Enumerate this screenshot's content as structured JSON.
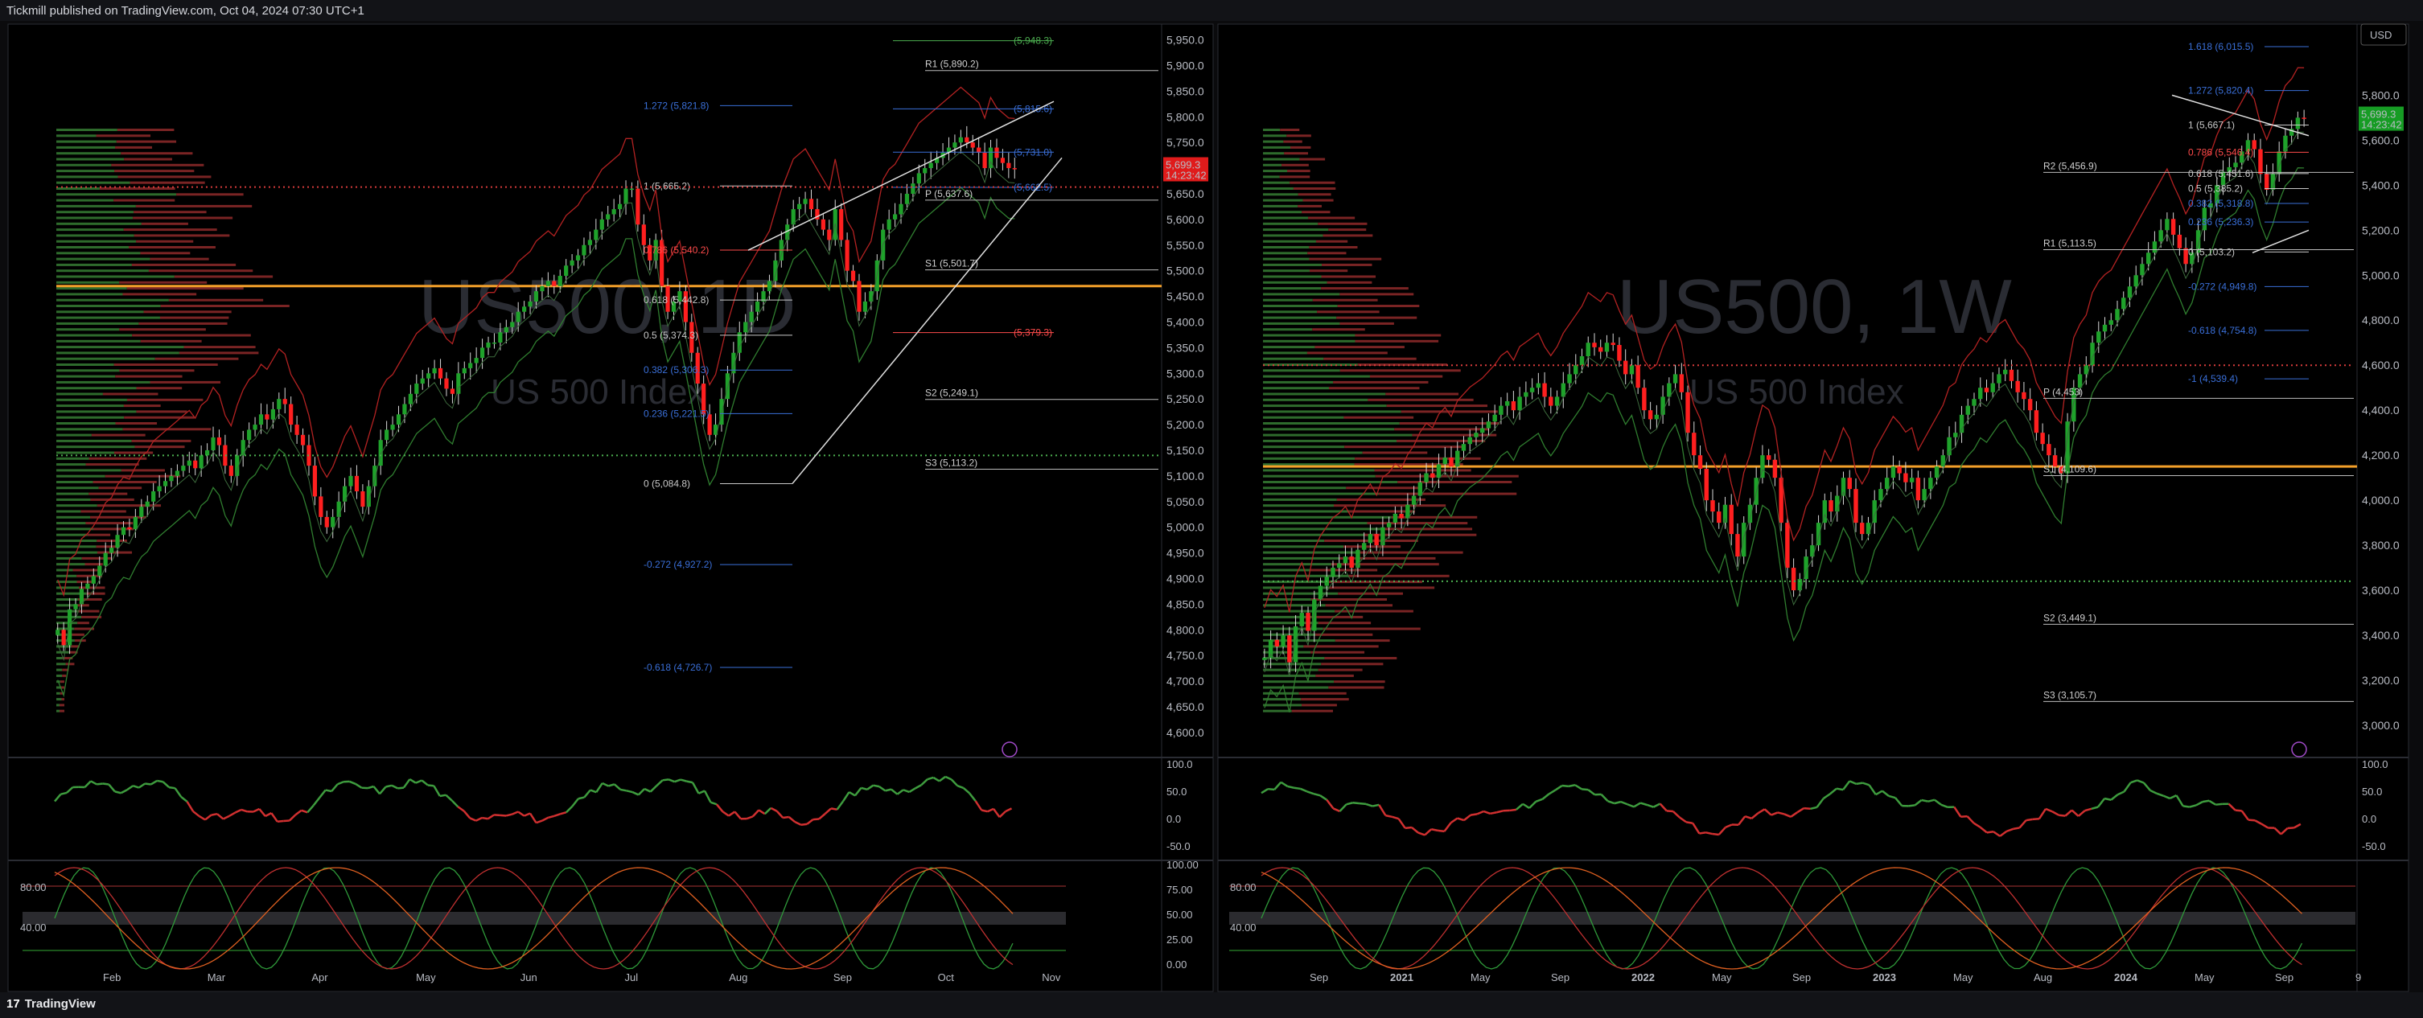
{
  "header": {
    "published": "Tickmill published on TradingView.com, Oct 04, 2024 07:30 UTC+1"
  },
  "footer": {
    "brand": "TradingView"
  },
  "currency_button": "USD",
  "chart_data": [
    {
      "type": "candlestick",
      "symbol": "US500, 1D",
      "subtitle": "US 500 Index",
      "ylim": [
        4570,
        5965
      ],
      "yticks": [
        4600,
        4650,
        4700,
        4750,
        4800,
        4850,
        4900,
        4950,
        5000,
        5050,
        5100,
        5150,
        5200,
        5250,
        5300,
        5350,
        5400,
        5450,
        5500,
        5550,
        5600,
        5650,
        5700,
        5750,
        5800,
        5850,
        5900,
        5950
      ],
      "xticks": [
        "Feb",
        "Mar",
        "Apr",
        "May",
        "Jun",
        "Jul",
        "Aug",
        "Sep",
        "Oct",
        "Nov"
      ],
      "last_price": "5,699.3",
      "countdown": "14:23:42",
      "closes": [
        4800,
        4770,
        4840,
        4850,
        4880,
        4890,
        4905,
        4925,
        4950,
        4960,
        4985,
        5000,
        4996,
        5020,
        5040,
        5050,
        5070,
        5080,
        5090,
        5100,
        5110,
        5120,
        5130,
        5115,
        5140,
        5150,
        5175,
        5160,
        5120,
        5100,
        5140,
        5170,
        5190,
        5200,
        5220,
        5210,
        5230,
        5250,
        5240,
        5200,
        5180,
        5160,
        5120,
        5060,
        5020,
        5000,
        5020,
        5050,
        5080,
        5100,
        5070,
        5040,
        5080,
        5120,
        5170,
        5190,
        5200,
        5220,
        5240,
        5260,
        5280,
        5290,
        5300,
        5310,
        5290,
        5270,
        5260,
        5300,
        5310,
        5320,
        5330,
        5350,
        5360,
        5360,
        5380,
        5390,
        5400,
        5420,
        5430,
        5440,
        5460,
        5470,
        5480,
        5470,
        5490,
        5510,
        5520,
        5530,
        5550,
        5560,
        5580,
        5600,
        5610,
        5620,
        5630,
        5660,
        5660,
        5590,
        5550,
        5520,
        5560,
        5470,
        5420,
        5440,
        5460,
        5400,
        5340,
        5280,
        5220,
        5180,
        5200,
        5250,
        5300,
        5340,
        5380,
        5400,
        5420,
        5440,
        5460,
        5480,
        5520,
        5560,
        5590,
        5620,
        5630,
        5640,
        5620,
        5600,
        5580,
        5560,
        5620,
        5560,
        5500,
        5480,
        5420,
        5440,
        5460,
        5520,
        5580,
        5600,
        5610,
        5630,
        5650,
        5670,
        5690,
        5700,
        5710,
        5720,
        5730,
        5740,
        5750,
        5760,
        5750,
        5740,
        5730,
        5700,
        5740,
        5720,
        5710,
        5700,
        5699
      ],
      "fibs_left": [
        {
          "label": "1.272 (5,821.8)",
          "value": 5821.8
        },
        {
          "label": "1 (5,665.2)",
          "value": 5665.2
        },
        {
          "label": "0.786 (5,540.2)",
          "value": 5540.2
        },
        {
          "label": "0.618 (5,442.8)",
          "value": 5442.8
        },
        {
          "label": "0.5 (5,374.3)",
          "value": 5374.3
        },
        {
          "label": "0.382 (5,306.3)",
          "value": 5306.3
        },
        {
          "label": "0.236 (5,221.5)",
          "value": 5221.5
        },
        {
          "label": "0 (5,084.8)",
          "value": 5084.8
        },
        {
          "label": "-0.272 (4,927.2)",
          "value": 4927.2
        },
        {
          "label": "-0.618 (4,726.7)",
          "value": 4726.7
        }
      ],
      "fibs_right": [
        {
          "label": "(5,948.3)",
          "value": 5948.3
        },
        {
          "label": "(5,815.6)",
          "value": 5815.6
        },
        {
          "label": "(5,731.0)",
          "value": 5731.0
        },
        {
          "label": "(5,662.5)",
          "value": 5662.5
        },
        {
          "label": "(5,379.3)",
          "value": 5379.3
        }
      ],
      "pivots": [
        {
          "label": "R1 (5,890.2)",
          "value": 5890.2
        },
        {
          "label": "P (5,637.6)",
          "value": 5637.6
        },
        {
          "label": "S1 (5,501.7)",
          "value": 5501.7
        },
        {
          "label": "S2 (5,249.1)",
          "value": 5249.1
        },
        {
          "label": "S3 (5,113.2)",
          "value": 5113.2
        }
      ],
      "poc_level": 5470,
      "rsi_ticks": [
        "100.0",
        "50.0",
        "0.0",
        "-50.0"
      ],
      "stoch_ticks_left": [
        "80.00",
        "40.00"
      ],
      "stoch_ticks_right": [
        "100.00",
        "75.00",
        "50.00",
        "25.00",
        "0.00"
      ]
    },
    {
      "type": "candlestick",
      "symbol": "US500, 1W",
      "subtitle": "US 500 Index",
      "ylim": [
        2900,
        6080
      ],
      "yticks": [
        3000,
        3200,
        3400,
        3600,
        3800,
        4000,
        4200,
        4400,
        4600,
        4800,
        5000,
        5200,
        5400,
        5600,
        5800
      ],
      "xticks": [
        "Sep",
        "2021",
        "May",
        "Sep",
        "2022",
        "May",
        "Sep",
        "2023",
        "May",
        "Aug",
        "2024",
        "May",
        "Sep",
        "9"
      ],
      "last_price": "5,699.3",
      "countdown": "14:23:42",
      "closes": [
        3300,
        3380,
        3350,
        3400,
        3280,
        3440,
        3500,
        3420,
        3560,
        3620,
        3660,
        3700,
        3720,
        3750,
        3700,
        3780,
        3810,
        3850,
        3800,
        3880,
        3900,
        3940,
        3920,
        3980,
        4020,
        4080,
        4120,
        4100,
        4160,
        4190,
        4150,
        4220,
        4250,
        4280,
        4300,
        4320,
        4350,
        4380,
        4420,
        4440,
        4400,
        4460,
        4480,
        4500,
        4520,
        4460,
        4420,
        4460,
        4520,
        4560,
        4600,
        4640,
        4700,
        4680,
        4660,
        4700,
        4690,
        4620,
        4560,
        4600,
        4500,
        4400,
        4360,
        4380,
        4460,
        4520,
        4560,
        4480,
        4300,
        4200,
        4140,
        4000,
        3950,
        3900,
        3980,
        3850,
        3750,
        3900,
        3980,
        4100,
        4200,
        4180,
        4100,
        3900,
        3700,
        3600,
        3650,
        3750,
        3800,
        3900,
        4000,
        3950,
        4020,
        4100,
        4050,
        3900,
        3850,
        3900,
        4000,
        4050,
        4100,
        4150,
        4120,
        4080,
        4100,
        4000,
        4050,
        4100,
        4150,
        4200,
        4280,
        4300,
        4380,
        4420,
        4450,
        4500,
        4480,
        4520,
        4560,
        4580,
        4530,
        4480,
        4450,
        4400,
        4300,
        4250,
        4200,
        4150,
        4120,
        4350,
        4500,
        4560,
        4600,
        4700,
        4750,
        4780,
        4800,
        4850,
        4900,
        4950,
        5000,
        5050,
        5100,
        5150,
        5200,
        5250,
        5180,
        5120,
        5050,
        5100,
        5200,
        5300,
        5320,
        5400,
        5460,
        5480,
        5500,
        5550,
        5600,
        5560,
        5450,
        5380,
        5450,
        5550,
        5620,
        5650,
        5700,
        5699
      ],
      "fibs_left": [
        {
          "label": "1.618 (6,015.5)",
          "value": 6015.5
        },
        {
          "label": "1.272 (5,820.4)",
          "value": 5820.4
        },
        {
          "label": "1 (5,667.1)",
          "value": 5667.1
        },
        {
          "label": "0.786 (5,546.4)",
          "value": 5546.4
        },
        {
          "label": "0.618 (5,451.6)",
          "value": 5451.6
        },
        {
          "label": "0.5 (5,385.2)",
          "value": 5385.2
        },
        {
          "label": "0.382 (5,318.8)",
          "value": 5318.8
        },
        {
          "label": "0.236 (5,236.3)",
          "value": 5236.3
        },
        {
          "label": "0 (5,103.2)",
          "value": 5103.2
        },
        {
          "label": "-0.272 (4,949.8)",
          "value": 4949.8
        },
        {
          "label": "-0.618 (4,754.8)",
          "value": 4754.8
        },
        {
          "label": "-1 (4,539.4)",
          "value": 4539.4
        }
      ],
      "fibs_right": [],
      "pivots": [
        {
          "label": "R2 (5,456.9)",
          "value": 5456.9
        },
        {
          "label": "R1 (5,113.5)",
          "value": 5113.5
        },
        {
          "label": "P (4,453)",
          "value": 4453
        },
        {
          "label": "S1 (4,109.6)",
          "value": 4109.6
        },
        {
          "label": "S2 (3,449.1)",
          "value": 3449.1
        },
        {
          "label": "S3 (3,105.7)",
          "value": 3105.7
        }
      ],
      "poc_level": 4150,
      "rsi_ticks": [
        "100.0",
        "50.0",
        "0.0",
        "-50.0"
      ],
      "stoch_ticks_left": [
        "80.00",
        "40.00"
      ],
      "stoch_ticks_right": []
    }
  ]
}
